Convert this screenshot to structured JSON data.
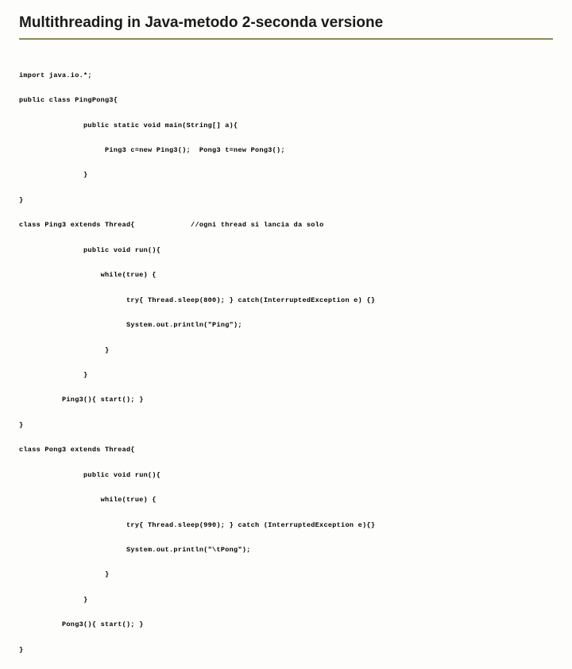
{
  "title": "Multithreading in Java-metodo 2-seconda versione",
  "code": {
    "l0": "import java.io.*;",
    "l1": "public class PingPong3{",
    "l2": "               public static void main(String[] a){",
    "l3": "                    Ping3 c=new Ping3();  Pong3 t=new Pong3();",
    "l4": "               }",
    "l5": "}",
    "l6a": "class Ping3 extends Thread{",
    "l6b": "//ogni thread si lancia da solo",
    "l7": "               public void run(){",
    "l8": "                   while(true) {",
    "l9": "                         try{ Thread.sleep(800); } catch(InterruptedException e) {}",
    "l10": "                         System.out.println(\"Ping\");",
    "l11": "                    }",
    "l12": "               }",
    "l13": "          Ping3(){ start(); }",
    "l14": "}",
    "l15": "class Pong3 extends Thread{",
    "l16": "               public void run(){",
    "l17": "                   while(true) {",
    "l18": "                         try{ Thread.sleep(990); } catch (InterruptedException e){}",
    "l19": "                         System.out.println(\"\\tPong\");",
    "l20": "                    }",
    "l21": "               }",
    "l22": "          Pong3(){ start(); }",
    "l23": "}"
  }
}
